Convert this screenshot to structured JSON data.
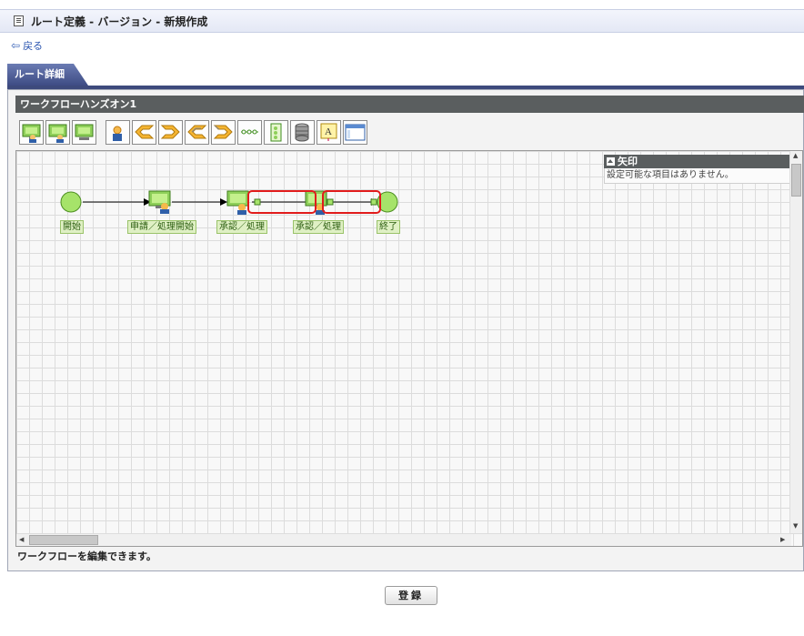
{
  "window": {
    "title": "ルート定義 - バージョン - 新規作成"
  },
  "nav": {
    "back_label": "戻る"
  },
  "tabs": [
    {
      "label": "ルート詳細"
    }
  ],
  "workflow": {
    "name": "ワークフローハンズオン1",
    "toolbar_icons": [
      "apply-node-icon",
      "confirm-node-icon",
      "process-node-icon",
      "user-node-icon",
      "split-node-icon",
      "join-node-icon",
      "split-node-alt-icon",
      "join-node-alt-icon",
      "straight-line-icon",
      "vertical-node-icon",
      "database-icon",
      "text-label-icon",
      "window-icon"
    ],
    "nodes": [
      {
        "label": "開始",
        "type": "start"
      },
      {
        "label": "申請／処理開始",
        "type": "apply"
      },
      {
        "label": "承認／処理",
        "type": "approve"
      },
      {
        "label": "承認／処理",
        "type": "approve"
      },
      {
        "label": "終了",
        "type": "end"
      }
    ],
    "properties": {
      "title": "矢印",
      "message": "設定可能な項目はありません。"
    },
    "status": "ワークフローを編集できます。"
  },
  "actions": {
    "register_label": "登録"
  },
  "colors": {
    "node_green": "#9edc5a",
    "node_label_bg": "#dff0c4",
    "highlight_red": "#e11b1b",
    "tab_navy": "#3d4a7c"
  }
}
